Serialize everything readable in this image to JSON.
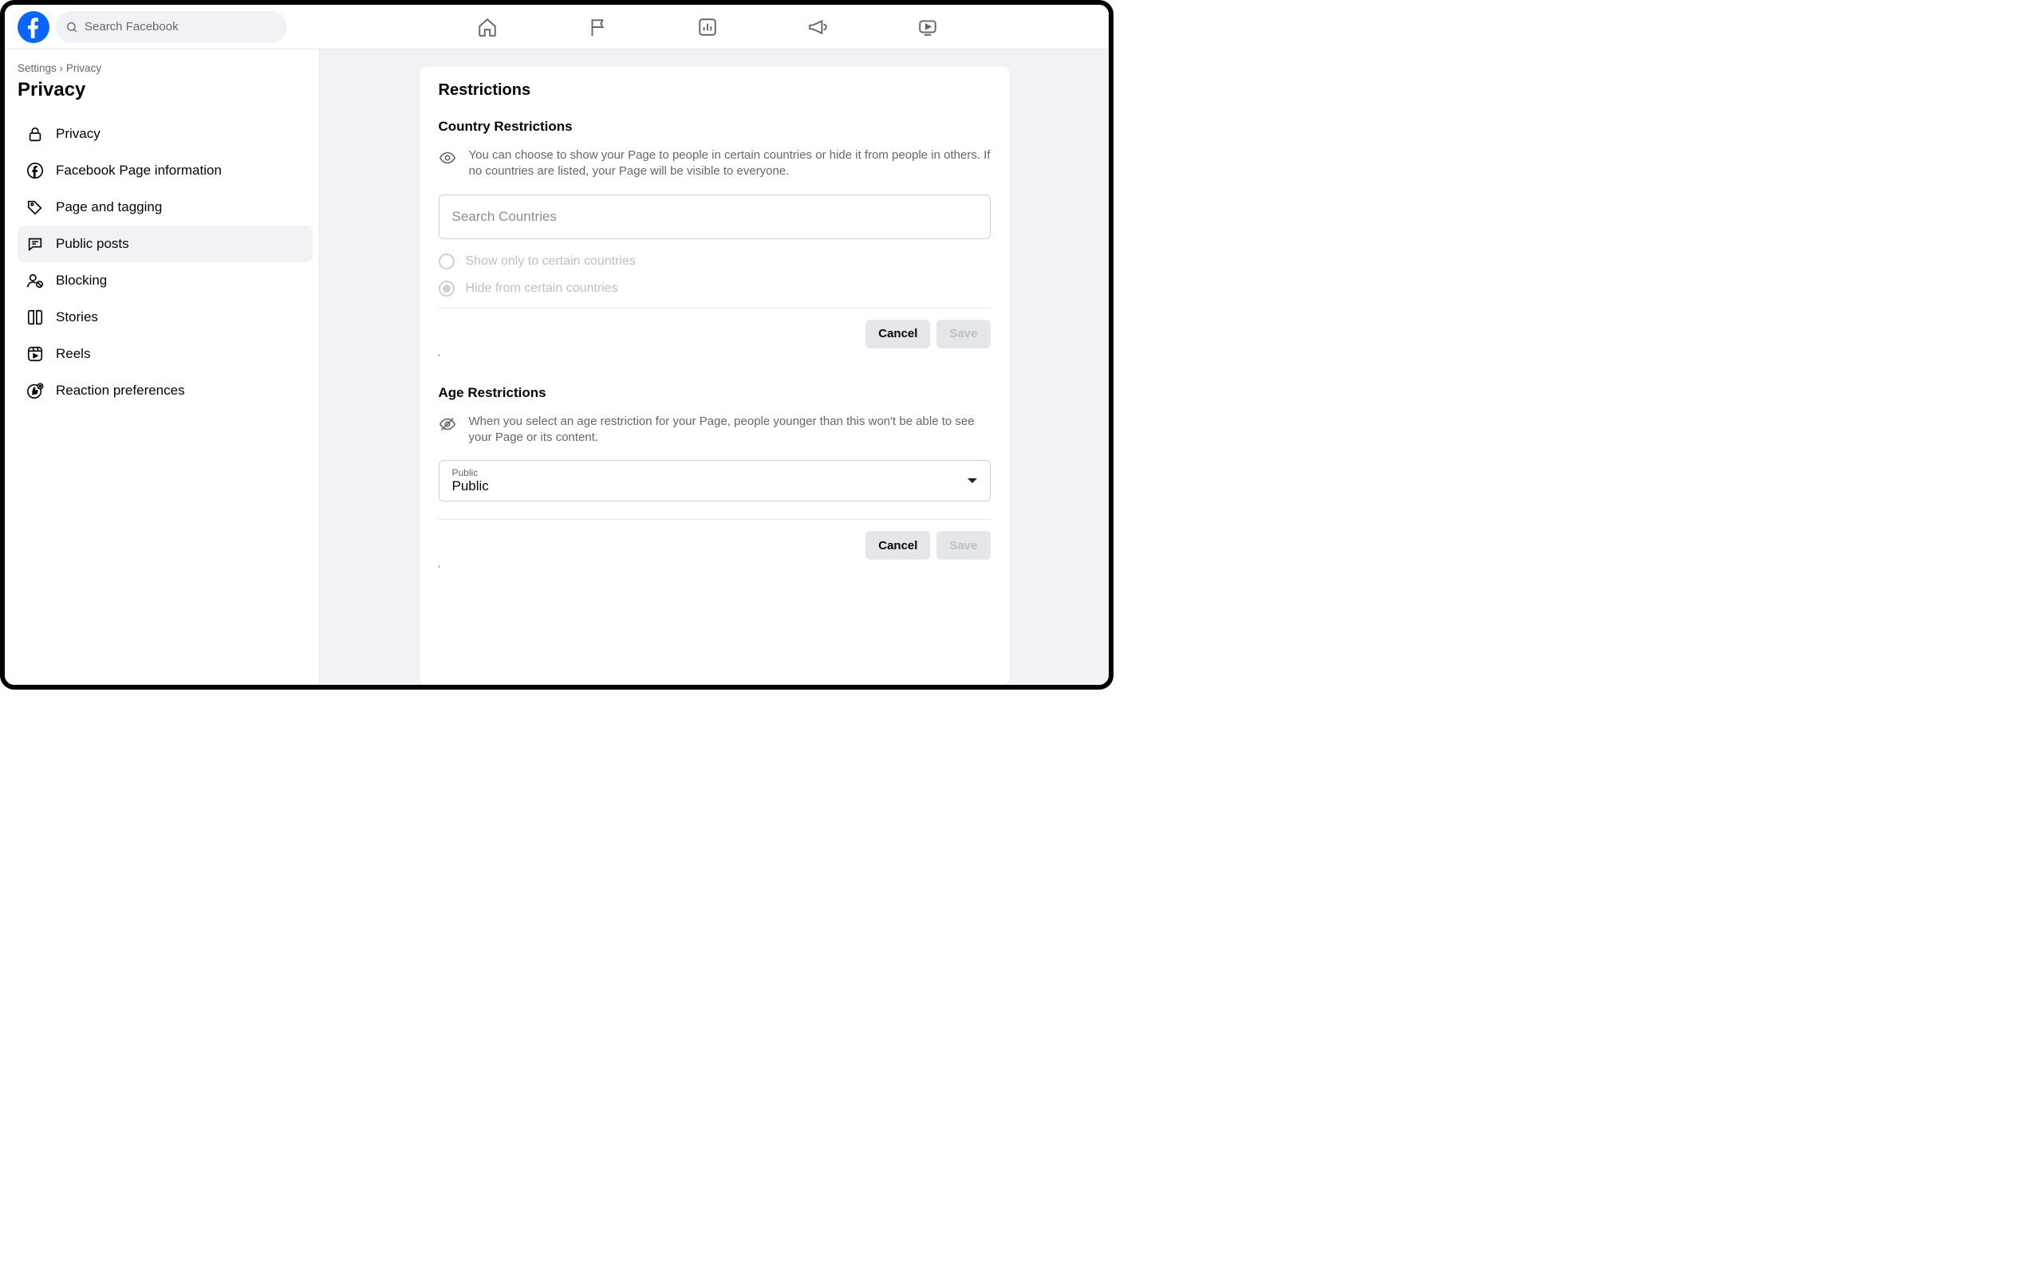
{
  "search": {
    "placeholder": "Search Facebook"
  },
  "breadcrumb": {
    "root": "Settings",
    "sep": "›",
    "current": "Privacy"
  },
  "pageTitle": "Privacy",
  "sidebar": {
    "items": [
      {
        "label": "Privacy"
      },
      {
        "label": "Facebook Page information"
      },
      {
        "label": "Page and tagging"
      },
      {
        "label": "Public posts"
      },
      {
        "label": "Blocking"
      },
      {
        "label": "Stories"
      },
      {
        "label": "Reels"
      },
      {
        "label": "Reaction preferences"
      }
    ]
  },
  "main": {
    "title": "Restrictions",
    "country": {
      "heading": "Country Restrictions",
      "desc": "You can choose to show your Page to people in certain countries or hide it from people in others. If no countries are listed, your Page will be visible to everyone.",
      "searchPlaceholder": "Search Countries",
      "radioShow": "Show only to certain countries",
      "radioHide": "Hide from certain countries",
      "cancel": "Cancel",
      "save": "Save",
      "tick": "'"
    },
    "age": {
      "heading": "Age Restrictions",
      "desc": "When you select an age restriction for your Page, people younger than this won't be able to see your Page or its content.",
      "selectLabel": "Public",
      "selectValue": "Public",
      "cancel": "Cancel",
      "save": "Save",
      "tick": "'"
    }
  }
}
